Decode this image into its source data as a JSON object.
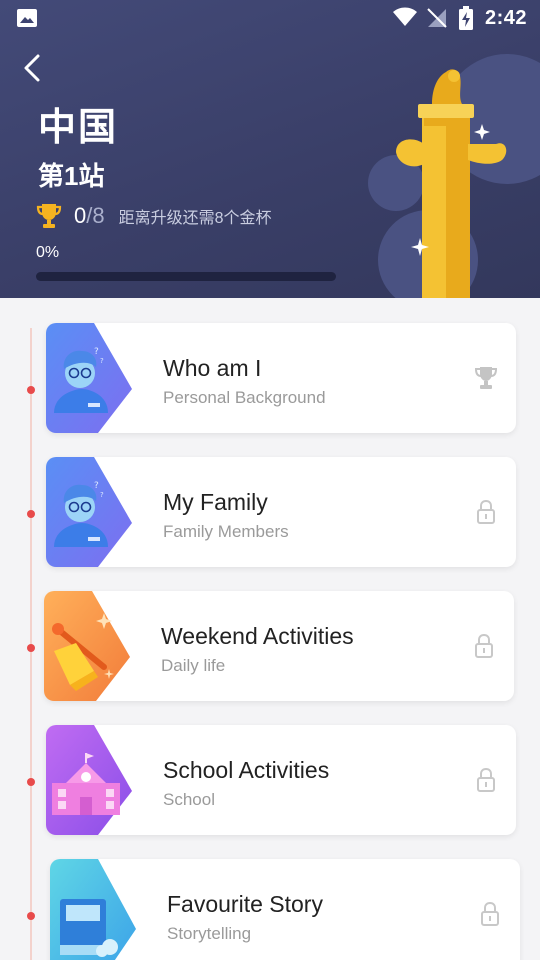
{
  "status_bar": {
    "time": "2:42"
  },
  "header": {
    "title": "中国",
    "station": "第1站",
    "cups_current": "0",
    "cups_sep": "/",
    "cups_total": "8",
    "hint": "距离升级还需8个金杯",
    "progress_label": "0%",
    "progress_value": 0
  },
  "colors": {
    "header_bg": "#3d4370",
    "accent_gold": "#f5c230",
    "timeline_dot": "#e84b4b"
  },
  "lessons": [
    {
      "title": "Who am I",
      "subtitle": "Personal Background",
      "status_icon": "trophy-icon",
      "thumb_icon": "student-avatar-icon"
    },
    {
      "title": "My Family",
      "subtitle": "Family Members",
      "status_icon": "lock-icon",
      "thumb_icon": "student-avatar-icon"
    },
    {
      "title": "Weekend Activities",
      "subtitle": "Daily life",
      "status_icon": "lock-icon",
      "thumb_icon": "broom-icon"
    },
    {
      "title": "School Activities",
      "subtitle": "School",
      "status_icon": "lock-icon",
      "thumb_icon": "school-building-icon"
    },
    {
      "title": "Favourite Story",
      "subtitle": "Storytelling",
      "status_icon": "lock-icon",
      "thumb_icon": "book-icon"
    }
  ]
}
